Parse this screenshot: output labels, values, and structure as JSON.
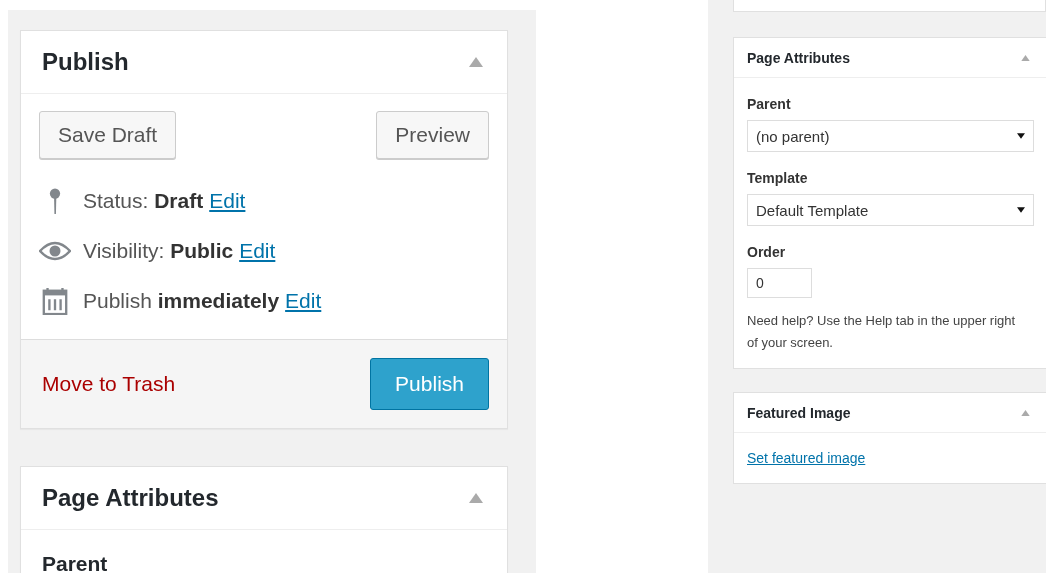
{
  "left_panel": {
    "publish_box": {
      "title": "Publish",
      "buttons": [
        "Save Draft",
        "Preview"
      ],
      "rows": [
        {
          "kind": "status",
          "label": "Status:",
          "value": "Draft",
          "link": "Edit"
        },
        {
          "kind": "visibility",
          "label": "Visibility:",
          "value": "Public",
          "link": "Edit"
        },
        {
          "kind": "schedule",
          "label": "Publish",
          "value": "immediately",
          "link": "Edit"
        }
      ],
      "trash_link": "Move to Trash",
      "publish_button": "Publish"
    },
    "page_attributes_box": {
      "title": "Page Attributes",
      "parent_label": "Parent"
    }
  },
  "right_panel": {
    "page_attributes_box": {
      "title": "Page Attributes",
      "parent_label": "Parent",
      "parent_select": "(no parent)",
      "template_label": "Template",
      "template_select": "Default Template",
      "order_label": "Order",
      "order_value": "0",
      "help": "Need help? Use the Help tab in the upper right of your screen."
    },
    "featured_image_box": {
      "title": "Featured Image",
      "link": "Set featured image"
    }
  }
}
